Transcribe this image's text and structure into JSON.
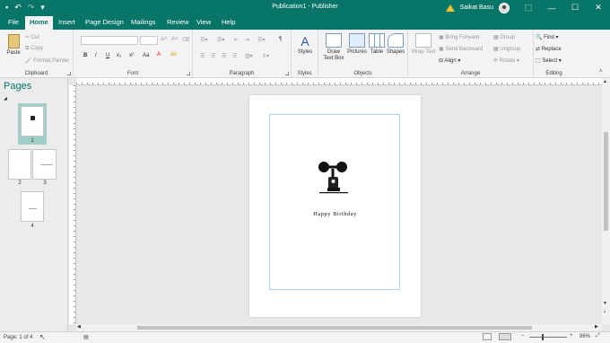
{
  "window": {
    "title": "Publication1  -  Publisher",
    "user": "Saikat Basu",
    "min": "—",
    "max": "☐",
    "close": "✕",
    "help_icon": "?"
  },
  "qat": {
    "save": "▪",
    "undo": "↶",
    "redo": "↷",
    "more": "▾"
  },
  "tabs": [
    "File",
    "Home",
    "Insert",
    "Page Design",
    "Mailings",
    "Review",
    "View",
    "Help"
  ],
  "ribbon": {
    "clipboard": {
      "paste": "Paste",
      "cut": "Cut",
      "copy": "Copy",
      "format_painter": "Format Painter",
      "label": "Clipboard"
    },
    "font": {
      "bold": "B",
      "italic": "I",
      "underline": "U",
      "sub": "x₂",
      "sup": "x²",
      "aa": "Aa",
      "label": "Font"
    },
    "paragraph": {
      "pilcrow": "¶",
      "label": "Paragraph"
    },
    "styles": {
      "styles": "Styles",
      "label": "Styles"
    },
    "objects": {
      "draw_text_box": "Draw Text Box",
      "pictures": "Pictures",
      "table": "Table",
      "shapes": "Shapes",
      "label": "Objects"
    },
    "arrange": {
      "wrap_text": "Wrap Text",
      "bring_forward": "Bring Forward",
      "send_backward": "Send Backward",
      "align": "Align",
      "group": "Group",
      "ungroup": "Ungroup",
      "rotate": "Rotate",
      "label": "Arrange"
    },
    "editing": {
      "find": "Find",
      "replace": "Replace",
      "select": "Select",
      "label": "Editing"
    }
  },
  "pages_pane": {
    "title": "Pages",
    "pages": [
      "1",
      "2",
      "3",
      "4"
    ]
  },
  "document": {
    "text": "Happy Birthday"
  },
  "status": {
    "page": "Page: 1 of 4",
    "zoom": "86%",
    "minus": "−",
    "plus": "+"
  }
}
